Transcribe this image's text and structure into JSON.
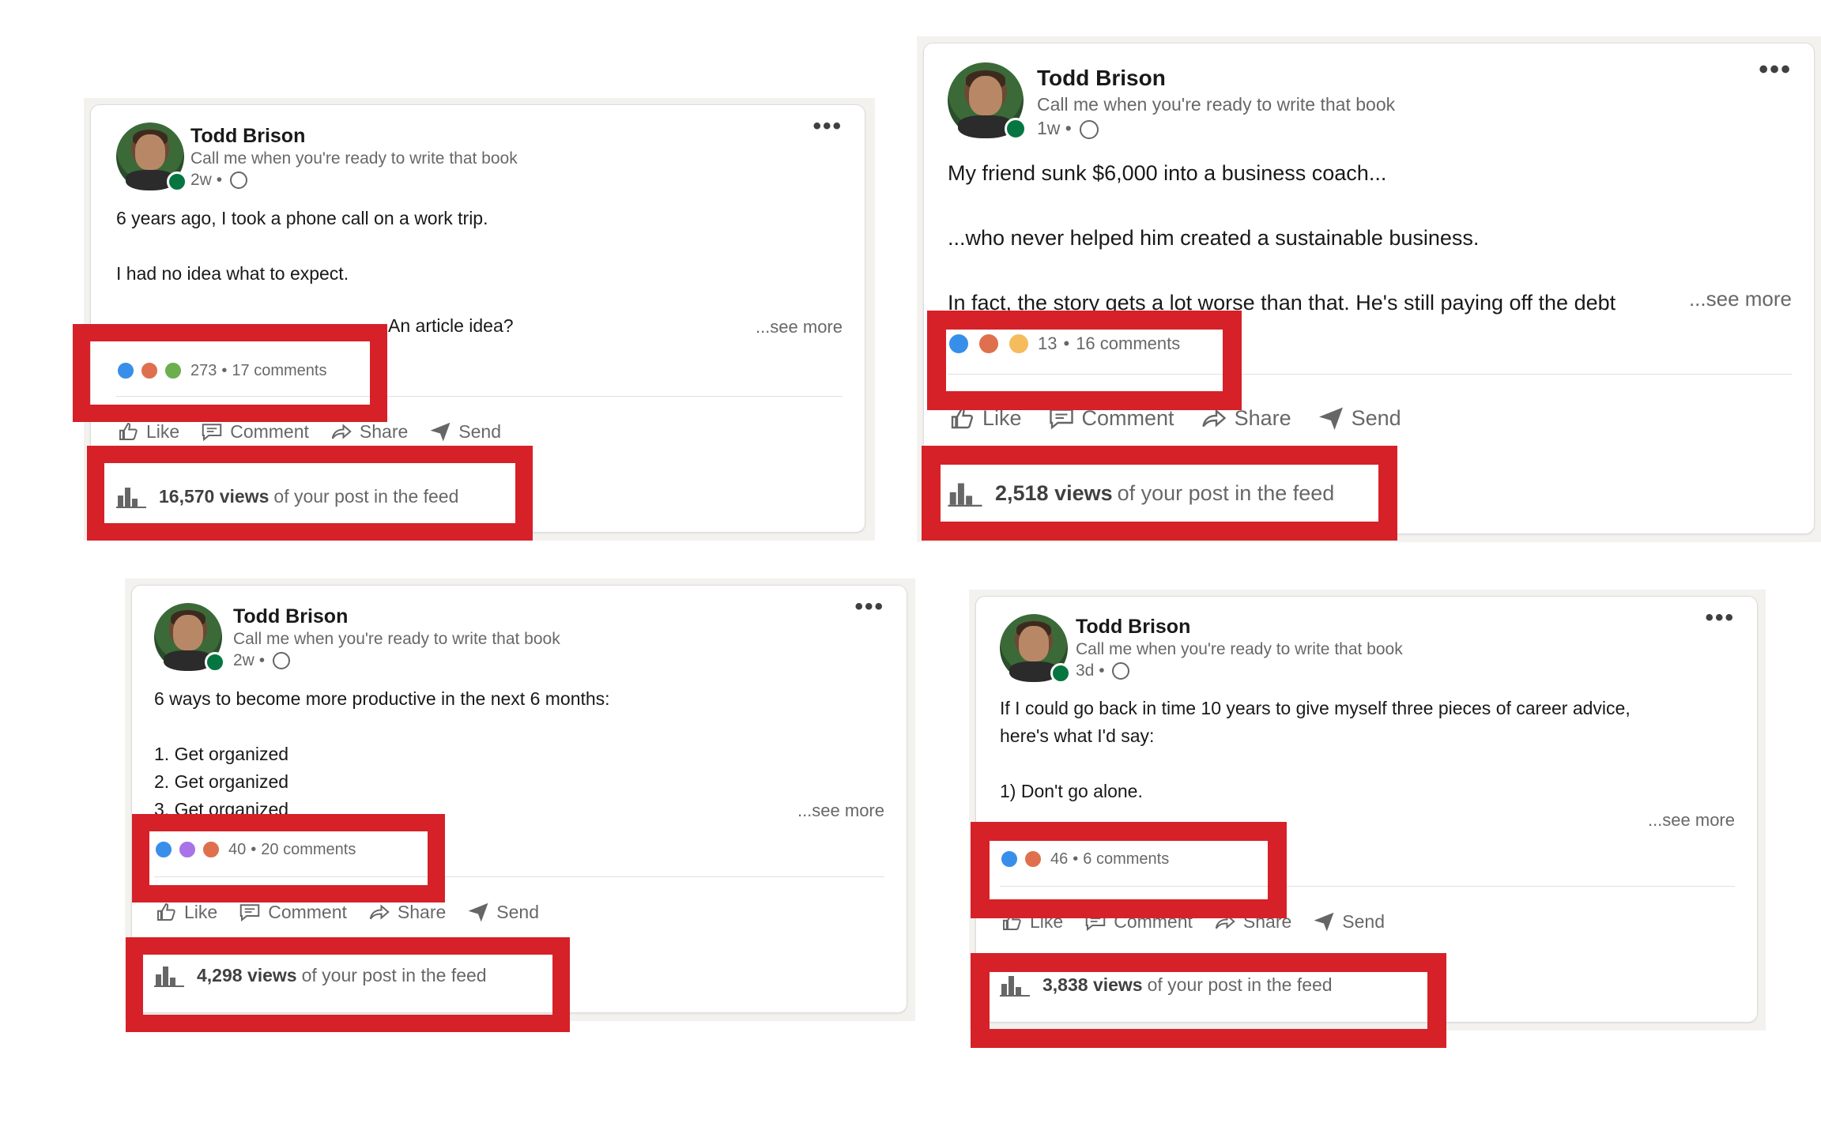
{
  "posts": [
    {
      "author": "Todd Brison",
      "headline": "Call me when you're ready to write that book",
      "time": "2w",
      "body": "6 years ago, I took a phone call on a work trip.\n\nI had no idea what to expect.\n\n",
      "body_tail": "An article idea?",
      "see_more": "...see more",
      "reactions": [
        "like",
        "love",
        "celebrate"
      ],
      "reaction_count": "273",
      "comments": "17 comments",
      "views_count": "16,570 views",
      "views_suffix": "of your post in the feed"
    },
    {
      "author": "Todd Brison",
      "headline": "Call me when you're ready to write that book",
      "time": "1w",
      "body": "My friend sunk $6,000 into a business coach...\n\n...who never helped him created a sustainable business.\n\nIn fact, the story gets a lot worse than that. He's still paying off the debt",
      "see_more": "...see more",
      "reactions": [
        "like",
        "love",
        "insight"
      ],
      "reaction_count": "13",
      "comments": "16 comments",
      "views_count": "2,518 views",
      "views_suffix": "of your post in the feed"
    },
    {
      "author": "Todd Brison",
      "headline": "Call me when you're ready to write that book",
      "time": "2w",
      "body": "6 ways to become more productive in the next 6 months:\n\n1. Get organized\n2. Get organized\n3. Get organized",
      "see_more": "...see more",
      "reactions": [
        "like",
        "support",
        "love"
      ],
      "reaction_count": "40",
      "comments": "20 comments",
      "views_count": "4,298 views",
      "views_suffix": "of your post in the feed"
    },
    {
      "author": "Todd Brison",
      "headline": "Call me when you're ready to write that book",
      "time": "3d",
      "body": "If I could go back in time 10 years to give myself three pieces of career advice,\nhere's what I'd say:\n\n1) Don't go alone.",
      "see_more": "...see more",
      "reactions": [
        "like",
        "love"
      ],
      "reaction_count": "46",
      "comments": "6 comments",
      "views_count": "3,838 views",
      "views_suffix": "of your post in the feed"
    }
  ],
  "actions": {
    "like": "Like",
    "comment": "Comment",
    "share": "Share",
    "send": "Send"
  },
  "separator": "•",
  "highlight_color": "#d62128"
}
